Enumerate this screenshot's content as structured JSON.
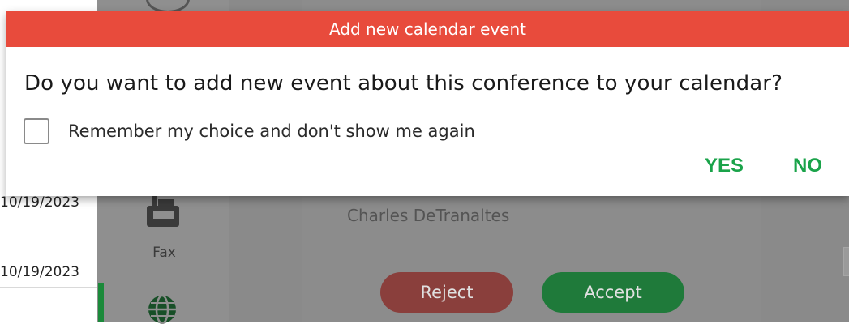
{
  "dialog": {
    "title": "Add new calendar event",
    "question": "Do you want to add new event about this conference to your calendar?",
    "remember_label": "Remember my choice and don't show me again",
    "remember_checked": false,
    "yes_label": "YES",
    "no_label": "NO",
    "title_color": "#e84b3c",
    "action_color": "#1aa34a"
  },
  "background": {
    "list_dates": [
      "10/19/2023",
      "10/19/2023"
    ],
    "rail": {
      "fax_label": "Fax"
    },
    "call": {
      "caller_name": "Charles DeTranaltes",
      "reject_label": "Reject",
      "accept_label": "Accept"
    }
  }
}
